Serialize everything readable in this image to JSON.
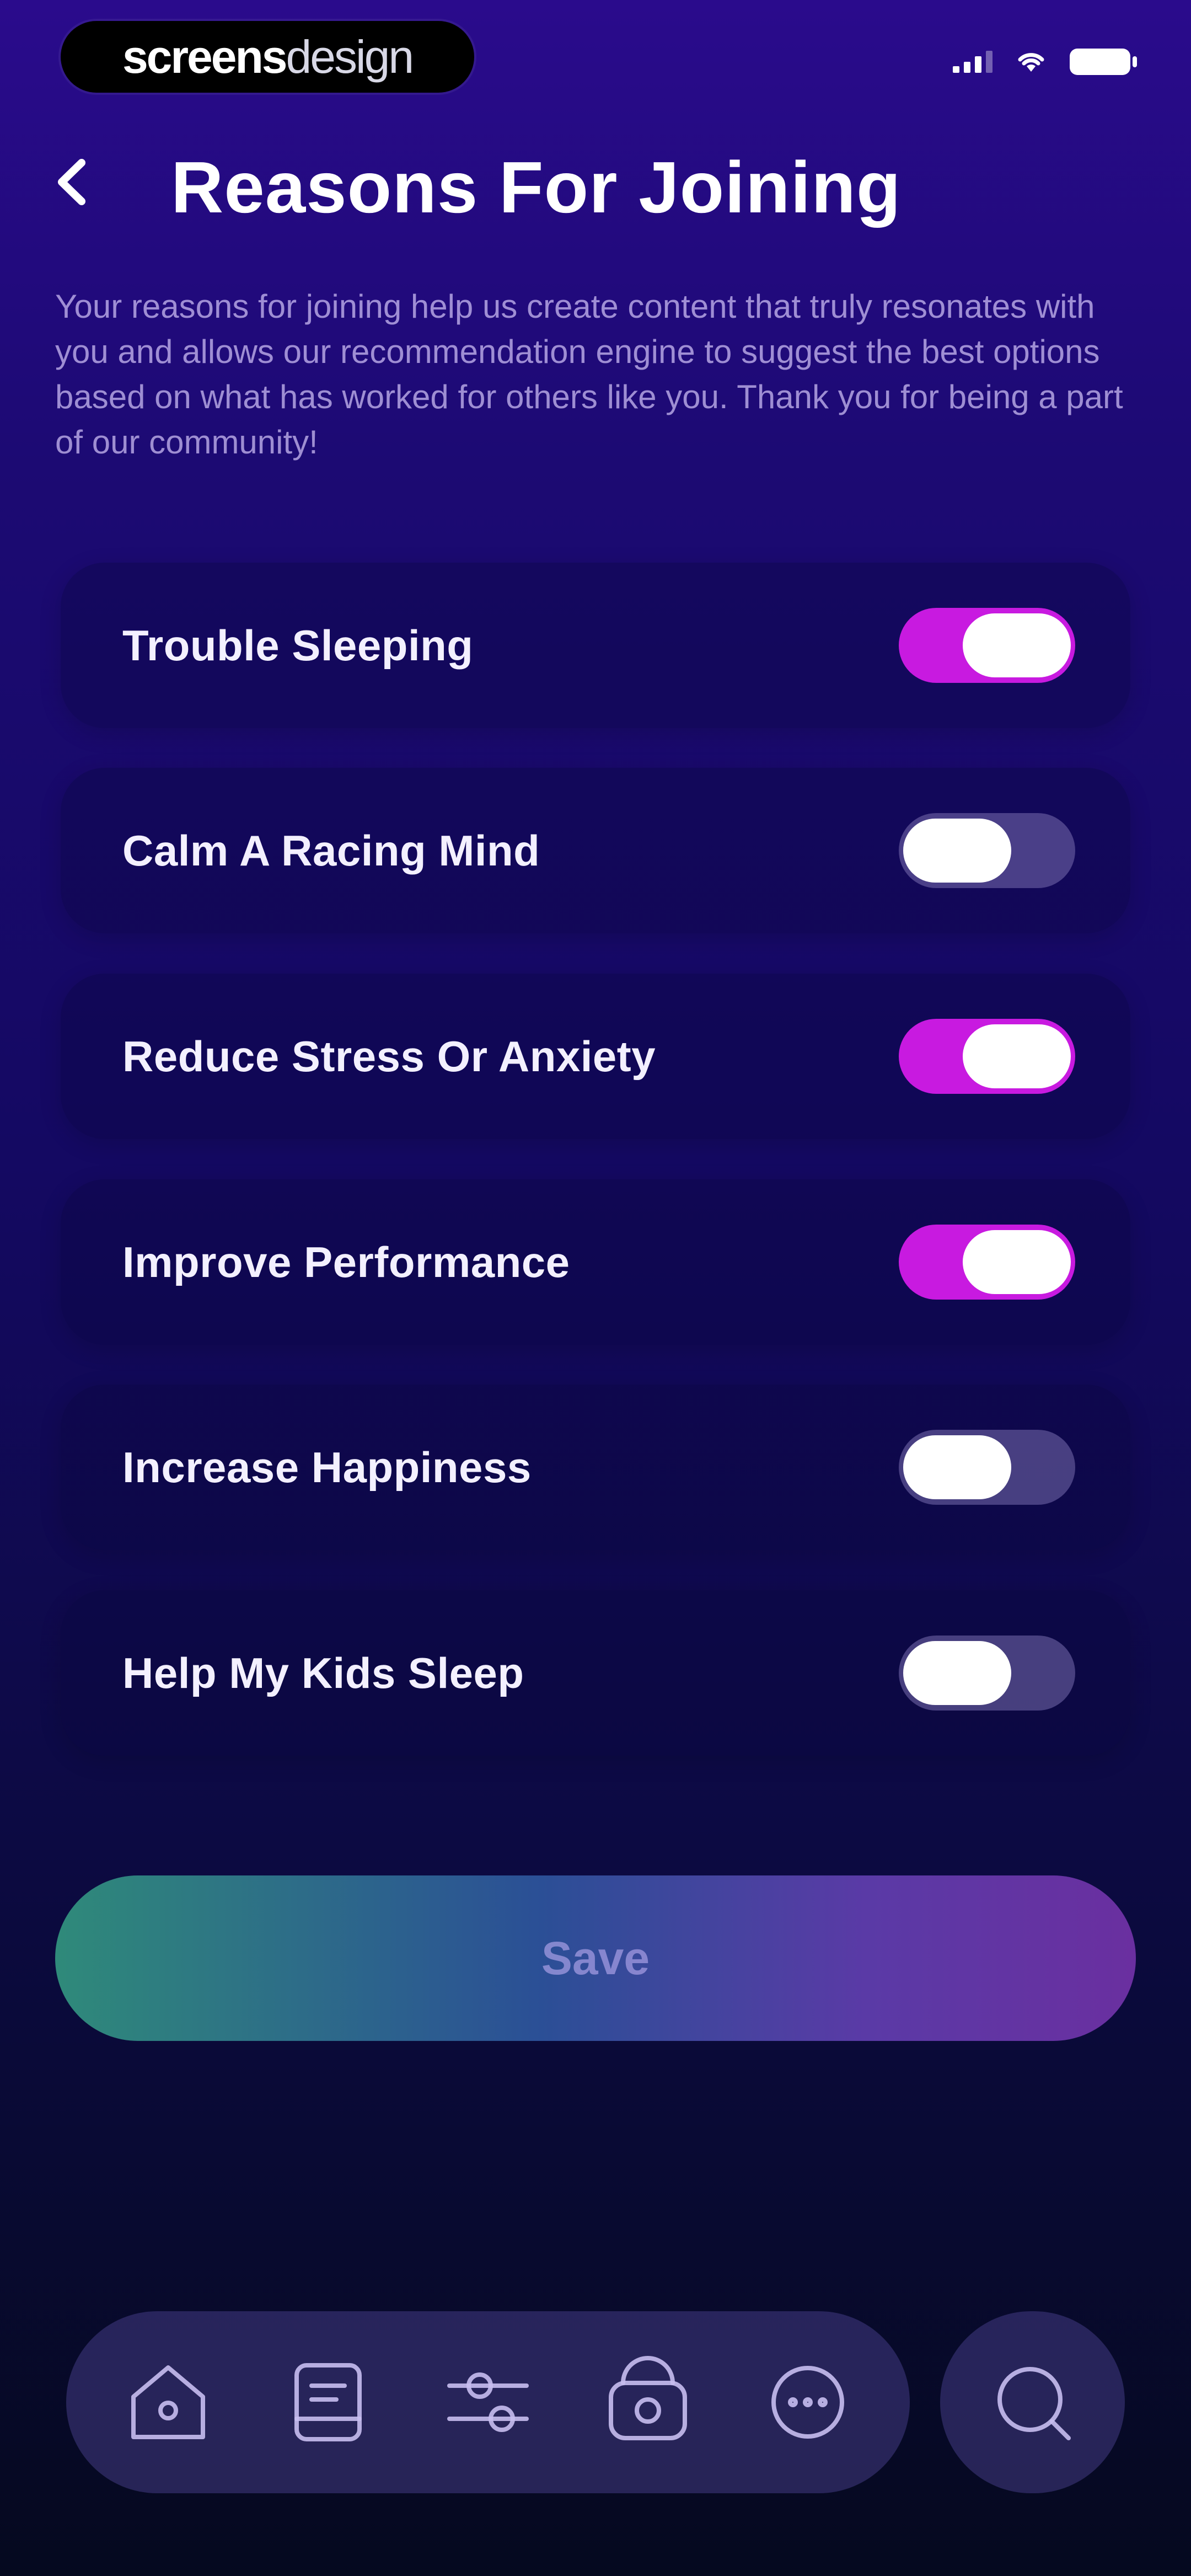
{
  "status_bar": {
    "brand_strong": "screens",
    "brand_light": "design",
    "icons": [
      "signal-icon",
      "wifi-icon",
      "battery-icon"
    ]
  },
  "header": {
    "back_icon": "chevron-left-icon",
    "title": "Reasons For Joining"
  },
  "description": "Your reasons for joining help us create content that truly resonates with you and allows our recommendation engine to suggest the best options based on what has worked for others like you. Thank you for being a part of our community!",
  "reasons": [
    {
      "label": "Trouble Sleeping",
      "enabled": true
    },
    {
      "label": "Calm A Racing Mind",
      "enabled": false
    },
    {
      "label": "Reduce Stress Or Anxiety",
      "enabled": true
    },
    {
      "label": "Improve Performance",
      "enabled": true
    },
    {
      "label": "Increase Happiness",
      "enabled": false
    },
    {
      "label": "Help My Kids Sleep",
      "enabled": false
    }
  ],
  "save_label": "Save",
  "nav": {
    "items": [
      "home-icon",
      "journal-icon",
      "sliders-icon",
      "radio-icon",
      "more-icon"
    ],
    "search_icon": "search-icon"
  },
  "colors": {
    "toggle_on": "#c81ae0",
    "toggle_off": "#786eaf",
    "background_top": "#2a0b8c",
    "background_bottom": "#05091f"
  }
}
